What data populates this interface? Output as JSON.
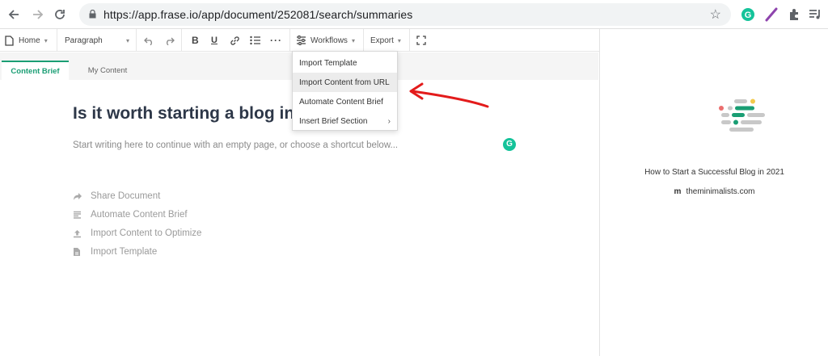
{
  "browser": {
    "url": "https://app.frase.io/app/document/252081/search/summaries",
    "icons": [
      "back-icon",
      "forward-icon",
      "reload-icon",
      "lock-icon",
      "star-icon",
      "grammarly-extension-icon",
      "pen-extension-icon",
      "puzzle-icon",
      "media-icon"
    ]
  },
  "toolbar": {
    "home_label": "Home",
    "paragraph_label": "Paragraph",
    "workflows_label": "Workflows",
    "export_label": "Export"
  },
  "tabs": [
    {
      "label": "Content Brief",
      "active": true
    },
    {
      "label": "My Content",
      "active": false
    }
  ],
  "document": {
    "title": "Is it worth starting a blog in",
    "placeholder": "Start writing here to continue with an empty page, or choose a shortcut below...",
    "shortcuts": [
      {
        "label": "Share Document",
        "icon": "share-icon"
      },
      {
        "label": "Automate Content Brief",
        "icon": "list-icon"
      },
      {
        "label": "Import Content to Optimize",
        "icon": "upload-icon"
      },
      {
        "label": "Import Template",
        "icon": "file-icon"
      }
    ]
  },
  "workflows_menu": {
    "items": [
      {
        "label": "Import Template",
        "highlighted": false
      },
      {
        "label": "Import Content from URL",
        "highlighted": true
      },
      {
        "label": "Automate Content Brief",
        "highlighted": false
      },
      {
        "label": "Insert Brief Section",
        "highlighted": false,
        "has_submenu": true
      }
    ]
  },
  "right_panel": {
    "source_title": "How to Start a Successful Blog in 2021",
    "source_domain_letter": "m",
    "source_domain": "theminimalists.com"
  },
  "colors": {
    "accent": "#1a9e74",
    "annotation_arrow": "#e31b1b",
    "grammarly": "#15c39a"
  }
}
